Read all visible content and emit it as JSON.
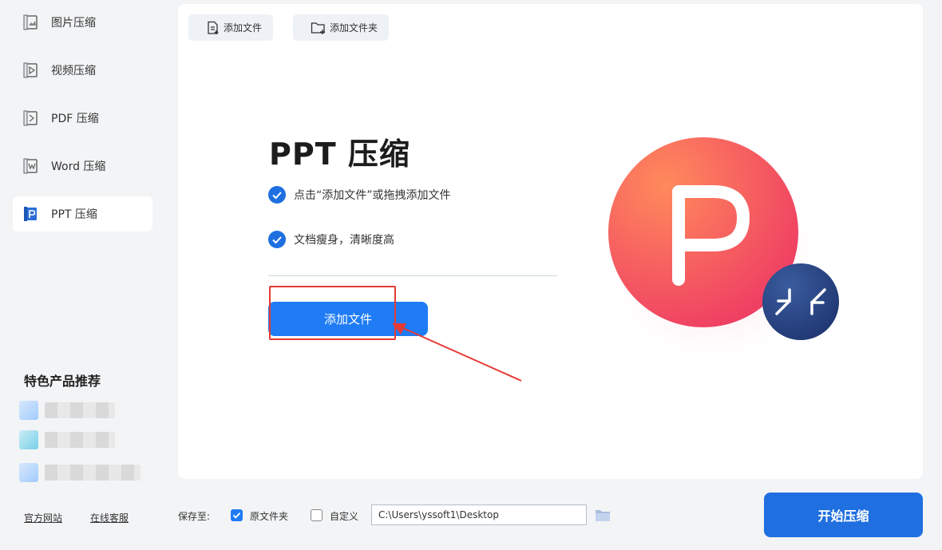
{
  "sidebar": {
    "items": [
      {
        "label": "图片压缩",
        "icon": "image-icon"
      },
      {
        "label": "视频压缩",
        "icon": "video-icon"
      },
      {
        "label": "PDF 压缩",
        "icon": "pdf-icon"
      },
      {
        "label": "Word 压缩",
        "icon": "word-icon"
      },
      {
        "label": "PPT 压缩",
        "icon": "ppt-icon",
        "active": true
      }
    ],
    "promo_title": "特色产品推荐",
    "links": {
      "official_site": "官方网站",
      "online_service": "在线客服"
    }
  },
  "toolbar": {
    "add_file": "添加文件",
    "add_folder": "添加文件夹"
  },
  "main": {
    "headline": "PPT 压缩",
    "features": [
      "点击“添加文件”或拖拽添加文件",
      "文档瘦身，清晰度高"
    ],
    "add_button": "添加文件"
  },
  "footer": {
    "save_to": "保存至:",
    "option_original": "原文件夹",
    "option_original_checked": true,
    "option_custom": "自定义",
    "option_custom_checked": false,
    "path_value": "C:\\Users\\yssoft1\\Desktop",
    "start_button": "开始压缩"
  },
  "colors": {
    "accent": "#1f7cf5",
    "start": "#1f6fe0",
    "highlight": "#e53935"
  }
}
